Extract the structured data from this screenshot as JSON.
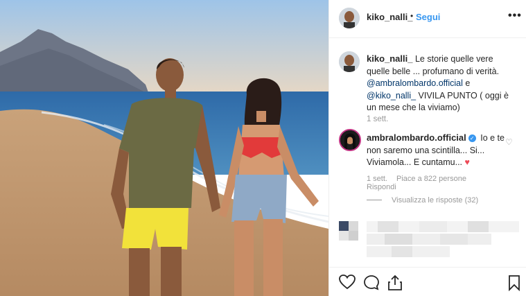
{
  "post": {
    "username": "kiko_nalli_",
    "separator": "•",
    "follow_label": "Segui",
    "more_icon": "more-horizontal-icon"
  },
  "caption": {
    "username": "kiko_nalli_",
    "text_part1": "Le storie quelle vere quelle belle ... profumano di verità.",
    "mention1": "@ambralombardo.official",
    "conj": " e ",
    "mention2": "@kiko_nalli_",
    "text_part2": " VIVILA PUNTO ( oggi è un mese che la viviamo)",
    "time": "1 sett."
  },
  "comment": {
    "username": "ambralombardo.official",
    "text": "Io e te non saremo una scintilla... Si... Viviamola... E cuntamu...",
    "heart_emoji": "♥",
    "time": "1 sett.",
    "likes": "Piace a 822 persone",
    "reply_label": "Rispondi",
    "view_replies": "Visualizza le risposte (32)"
  },
  "actions": {
    "like": "heart-icon",
    "comment": "comment-icon",
    "share": "share-icon",
    "save": "bookmark-icon"
  },
  "colors": {
    "accent": "#3897f0",
    "heart": "#ed4956",
    "muted": "#999999"
  }
}
